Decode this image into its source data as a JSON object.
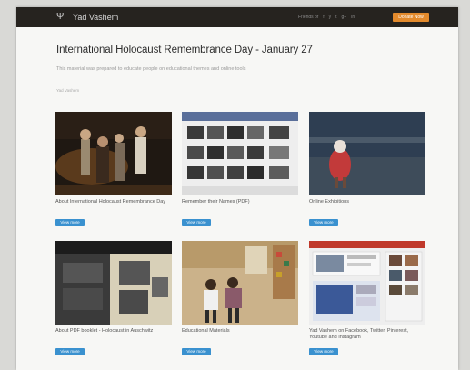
{
  "header": {
    "brand": "Yad Vashem",
    "nav_items": [
      "Friends of",
      "f",
      "y",
      "t",
      "g+",
      "in"
    ],
    "donate_label": "Donate Now"
  },
  "main": {
    "title": "International Holocaust Remembrance Day - January 27",
    "intro": "This material was prepared to educate people on educational themes and online tools",
    "meta": "Yad Vashem",
    "cards": [
      {
        "caption": "About International Holocaust Remembrance Day",
        "button": "View more"
      },
      {
        "caption": "Remember their Names (PDF)",
        "button": "View more"
      },
      {
        "caption": "Online Exhibitions",
        "button": "View more"
      },
      {
        "caption": "About PDF booklet - Holocaust in Auschwitz",
        "button": "View more"
      },
      {
        "caption": "Educational Materials",
        "button": "View more"
      },
      {
        "caption": "Yad Vashem on Facebook, Twitter, Pinterest, Youtube and Instagram",
        "button": "View more"
      }
    ]
  },
  "colors": {
    "topbar": "#26231f",
    "donate": "#e38a2c",
    "button": "#3a91cf"
  }
}
